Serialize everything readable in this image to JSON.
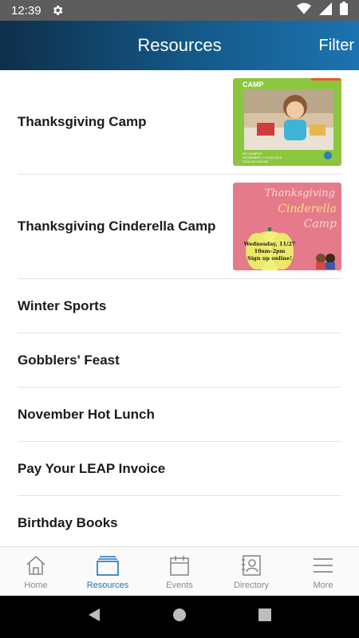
{
  "status_bar": {
    "time": "12:39"
  },
  "app_bar": {
    "title": "Resources",
    "filter_label": "Filter"
  },
  "list": {
    "items": [
      {
        "label": "Thanksgiving Camp",
        "thumb": {
          "title": "CAMP",
          "caption_line1": "ON CAMPUS",
          "caption_line2": "NOVEMBER 27 & 28, 2019",
          "caption_line3": "SIGN UP ONLINE"
        }
      },
      {
        "label": "Thanksgiving Cinderella Camp",
        "thumb": {
          "line1": "Thanksgiving",
          "line2": "Cinderella",
          "line3": "Camp",
          "pumpkin_line1": "Wednesday, 11/27",
          "pumpkin_line2": "10am-2pm",
          "pumpkin_line3": "Sign up online!"
        }
      },
      {
        "label": "Winter Sports"
      },
      {
        "label": "Gobblers' Feast"
      },
      {
        "label": "November Hot Lunch"
      },
      {
        "label": "Pay Your LEAP Invoice"
      },
      {
        "label": "Birthday Books"
      }
    ]
  },
  "bottom_nav": {
    "items": [
      {
        "label": "Home",
        "icon": "home-icon"
      },
      {
        "label": "Resources",
        "icon": "resources-icon"
      },
      {
        "label": "Events",
        "icon": "calendar-icon"
      },
      {
        "label": "Directory",
        "icon": "directory-icon"
      },
      {
        "label": "More",
        "icon": "menu-icon"
      }
    ],
    "active_index": 1
  },
  "colors": {
    "accent": "#1f73b7",
    "inactive": "#8a8a8a",
    "header_dark": "#0e2f4a",
    "header_light": "#1c73b0"
  }
}
